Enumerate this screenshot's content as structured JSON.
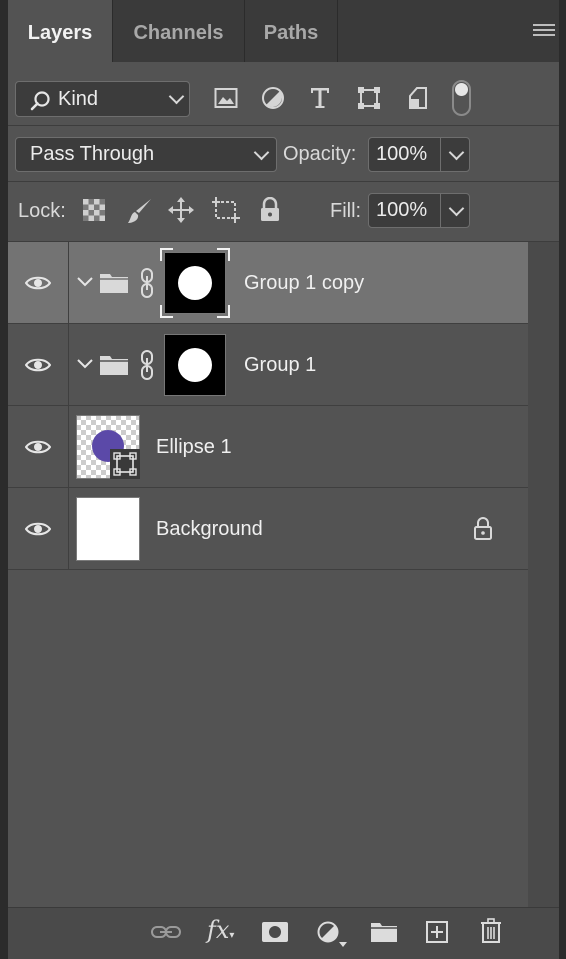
{
  "tabs": [
    {
      "label": "Layers",
      "active": true
    },
    {
      "label": "Channels",
      "active": false
    },
    {
      "label": "Paths",
      "active": false
    }
  ],
  "filter": {
    "kind_label": "Kind",
    "icons": [
      "image-filter-icon",
      "adjustment-filter-icon",
      "type-filter-icon",
      "shape-filter-icon",
      "smart-object-filter-icon",
      "filter-toggle"
    ]
  },
  "blend": {
    "mode": "Pass Through",
    "opacity_label": "Opacity:",
    "opacity_value": "100%"
  },
  "lock": {
    "label": "Lock:",
    "fill_label": "Fill:",
    "fill_value": "100%"
  },
  "layers": [
    {
      "name": "Group 1 copy",
      "type": "group",
      "selected": true,
      "visible": true
    },
    {
      "name": "Group 1",
      "type": "group",
      "selected": false,
      "visible": true
    },
    {
      "name": "Ellipse 1",
      "type": "shape",
      "selected": false,
      "visible": true,
      "color": "#5b49a8"
    },
    {
      "name": "Background",
      "type": "background",
      "selected": false,
      "visible": true,
      "locked": true
    }
  ],
  "footer_icons": [
    "link-layers-icon",
    "fx-icon",
    "add-mask-icon",
    "adjustment-layer-icon",
    "new-group-icon",
    "new-layer-icon",
    "delete-layer-icon"
  ],
  "colors": {
    "panel": "#535353",
    "selected_row": "#737373",
    "tabbar": "#3a3a3a",
    "shape_fill": "#5b49a8"
  }
}
